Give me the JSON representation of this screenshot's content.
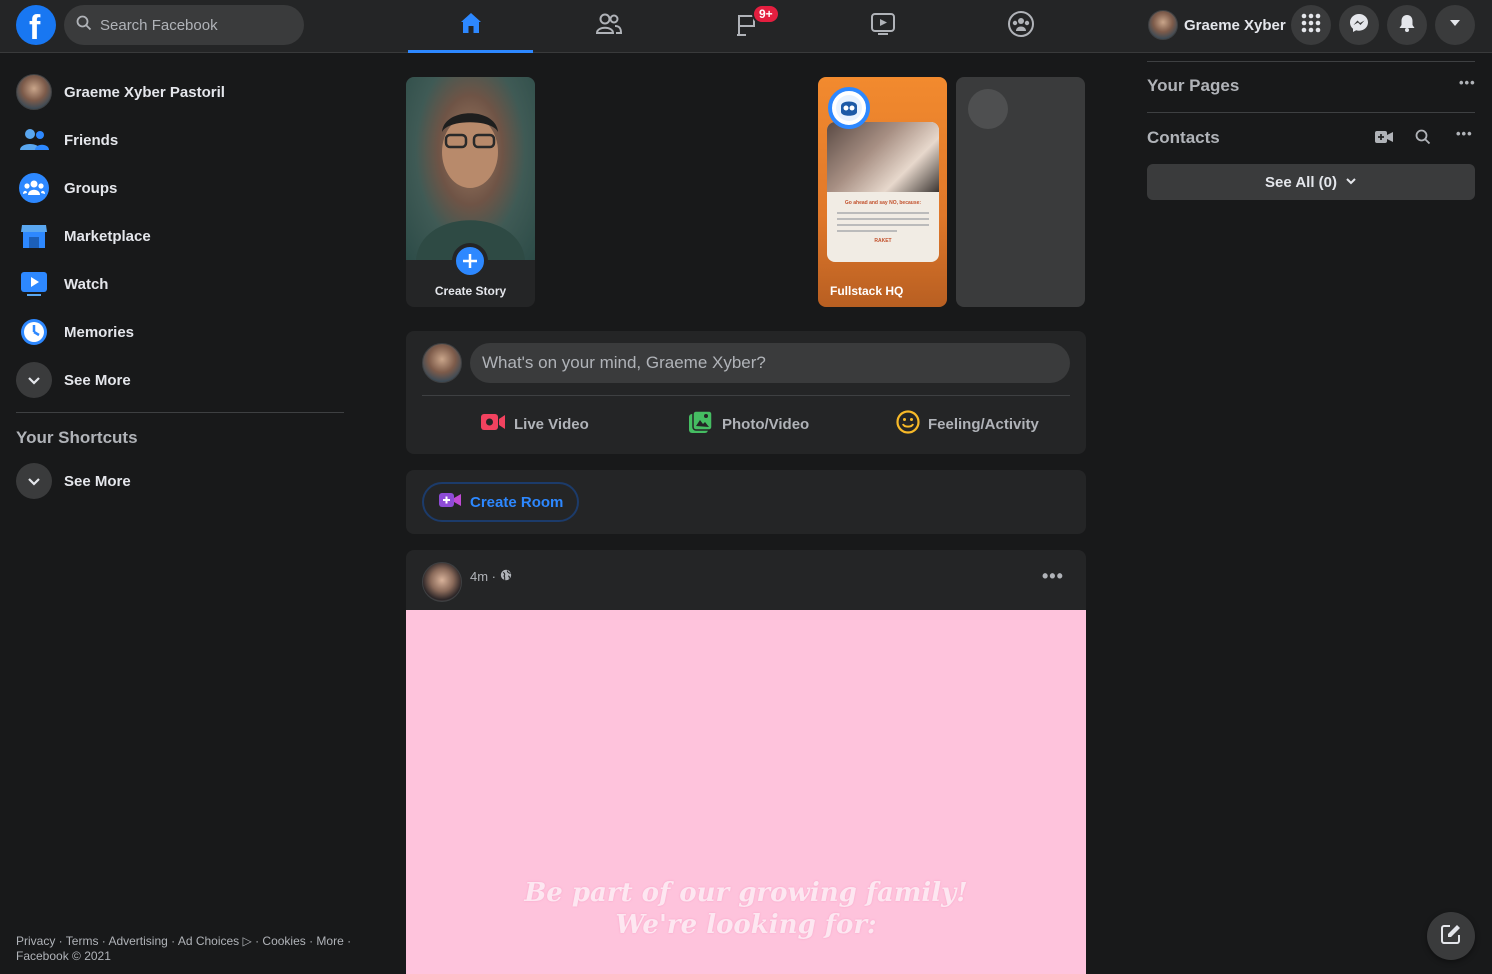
{
  "colors": {
    "accent": "#2d88ff",
    "brand": "#1877f2",
    "badge": "#e41e3f",
    "story_orange": "#f28a2e",
    "post_bg": "#fec3dc"
  },
  "topbar": {
    "search_placeholder": "Search Facebook",
    "tabs": [
      {
        "name": "home",
        "icon": "home-icon",
        "active": true
      },
      {
        "name": "friends",
        "icon": "friends-icon",
        "active": false
      },
      {
        "name": "pages",
        "icon": "flag-icon",
        "active": false,
        "badge": "9+"
      },
      {
        "name": "watch",
        "icon": "watch-icon",
        "active": false
      },
      {
        "name": "groups",
        "icon": "groups-icon",
        "active": false
      }
    ],
    "profile_name": "Graeme Xyber",
    "buttons": [
      "menu-grid-icon",
      "messenger-icon",
      "notifications-icon",
      "account-caret-icon"
    ]
  },
  "left": {
    "profile_name": "Graeme Xyber Pastoril",
    "items": [
      {
        "label": "Friends",
        "icon": "friends-icon"
      },
      {
        "label": "Groups",
        "icon": "groups-icon"
      },
      {
        "label": "Marketplace",
        "icon": "marketplace-icon"
      },
      {
        "label": "Watch",
        "icon": "watch-icon"
      },
      {
        "label": "Memories",
        "icon": "memories-icon"
      },
      {
        "label": "See More",
        "icon": "chevron-down-icon"
      }
    ],
    "shortcuts_title": "Your Shortcuts",
    "shortcuts_see_more": "See More",
    "footer_line1": "Privacy · Terms · Advertising · Ad Choices ▷ · Cookies · More ·",
    "footer_line2": "Facebook © 2021"
  },
  "stories": {
    "create_label": "Create Story",
    "items": [
      {
        "name": "Fullstack HQ"
      }
    ],
    "inner_card_title": "Go ahead and say NO, because:",
    "inner_card_brand": "RAKET"
  },
  "composer": {
    "placeholder": "What's on your mind, Graeme Xyber?",
    "actions": [
      "Live Video",
      "Photo/Video",
      "Feeling/Activity"
    ]
  },
  "room": {
    "label": "Create Room"
  },
  "post": {
    "time": "4m ·",
    "privacy_icon": "globe-icon",
    "media_line1": "Be part of our growing family!",
    "media_line2": "We're looking for:"
  },
  "right": {
    "pages_title": "Your Pages",
    "contacts_title": "Contacts",
    "see_all": "See All (0)"
  }
}
